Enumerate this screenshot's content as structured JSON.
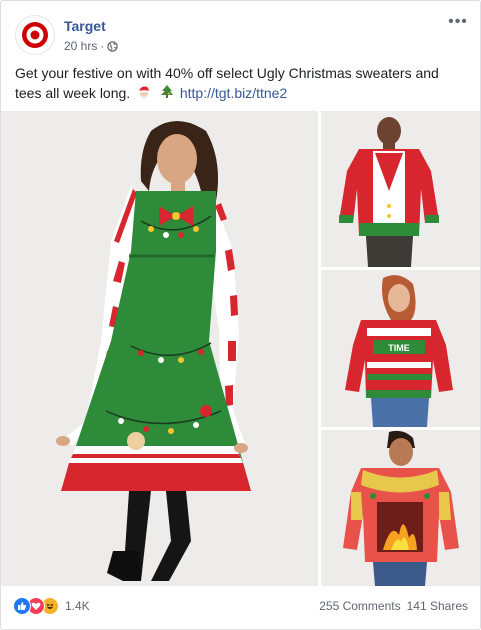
{
  "post": {
    "page_name": "Target",
    "time": "20 hrs",
    "separator": "·",
    "audience_icon": "globe-icon",
    "more_icon": "more-options-icon",
    "text": "Get your festive on with 40% off select Ugly Christmas sweaters and tees all week long.",
    "emoji_1": "santa-emoji",
    "emoji_2": "christmas-tree-emoji",
    "link": "http://tgt.biz/ttne2"
  },
  "images": [
    {
      "name": "woman-green-sweater-dress"
    },
    {
      "name": "man-red-vest-sweater"
    },
    {
      "name": "woman-red-time-sweater"
    },
    {
      "name": "man-fireplace-sweater"
    }
  ],
  "footer": {
    "reactions": [
      "like-icon",
      "love-icon",
      "haha-icon"
    ],
    "reaction_count": "1.4K",
    "comments": "255 Comments",
    "shares": "141 Shares"
  },
  "colors": {
    "brand_red": "#cc0000",
    "link_blue": "#385898"
  }
}
